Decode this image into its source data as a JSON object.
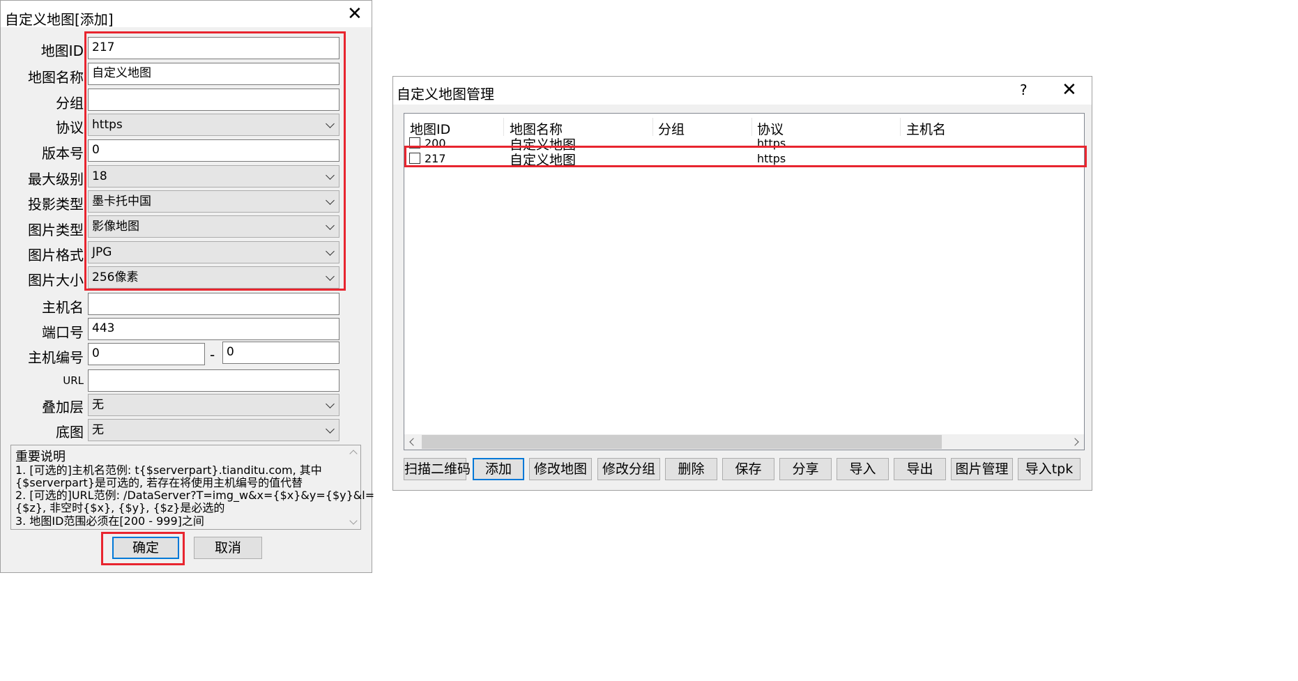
{
  "add_dialog": {
    "title": "自定义地图[添加]",
    "fields": {
      "map_id": {
        "label": "地图ID",
        "value": "217"
      },
      "map_name": {
        "label": "地图名称",
        "value": "自定义地图"
      },
      "group": {
        "label": "分组",
        "value": ""
      },
      "protocol": {
        "label": "协议",
        "value": "https"
      },
      "version": {
        "label": "版本号",
        "value": "0"
      },
      "max_level": {
        "label": "最大级别",
        "value": "18"
      },
      "projection": {
        "label": "投影类型",
        "value": "墨卡托中国"
      },
      "image_type": {
        "label": "图片类型",
        "value": "影像地图"
      },
      "image_format": {
        "label": "图片格式",
        "value": "JPG"
      },
      "image_size": {
        "label": "图片大小",
        "value": "256像素"
      },
      "host": {
        "label": "主机名",
        "value": ""
      },
      "port": {
        "label": "端口号",
        "value": "443"
      },
      "host_number": {
        "label": "主机编号",
        "from": "0",
        "separator": "-",
        "to": "0"
      },
      "url": {
        "label": "URL",
        "value": ""
      },
      "overlay": {
        "label": "叠加层",
        "value": "无"
      },
      "base_map": {
        "label": "底图",
        "value": "无"
      }
    },
    "notes": {
      "heading": "重要说明",
      "lines": [
        "1. [可选的]主机名范例: t{$serverpart}.tianditu.com, 其中",
        "{$serverpart}是可选的, 若存在将使用主机编号的值代替",
        "2. [可选的]URL范例: /DataServer?T=img_w&x={$x}&y={$y}&l=",
        "{$z}, 非空时{$x}, {$y}, {$z}是必选的",
        "3. 地图ID范围必须在[200 - 999]之间"
      ]
    },
    "ok_label": "确定",
    "cancel_label": "取消"
  },
  "manage_dialog": {
    "title": "自定义地图管理",
    "help_label": "?",
    "columns": [
      "地图ID",
      "地图名称",
      "分组",
      "协议",
      "主机名"
    ],
    "rows": [
      {
        "id": "200",
        "name": "自定义地图",
        "group": "",
        "protocol": "https",
        "host": ""
      },
      {
        "id": "217",
        "name": "自定义地图",
        "group": "",
        "protocol": "https",
        "host": ""
      }
    ],
    "buttons": [
      "扫描二维码",
      "添加",
      "修改地图",
      "修改分组",
      "删除",
      "保存",
      "分享",
      "导入",
      "导出",
      "图片管理",
      "导入tpk"
    ]
  },
  "colors": {
    "highlight": "#e8252f",
    "focus": "#0078d7",
    "dialog_bg": "#f0f0f0"
  }
}
